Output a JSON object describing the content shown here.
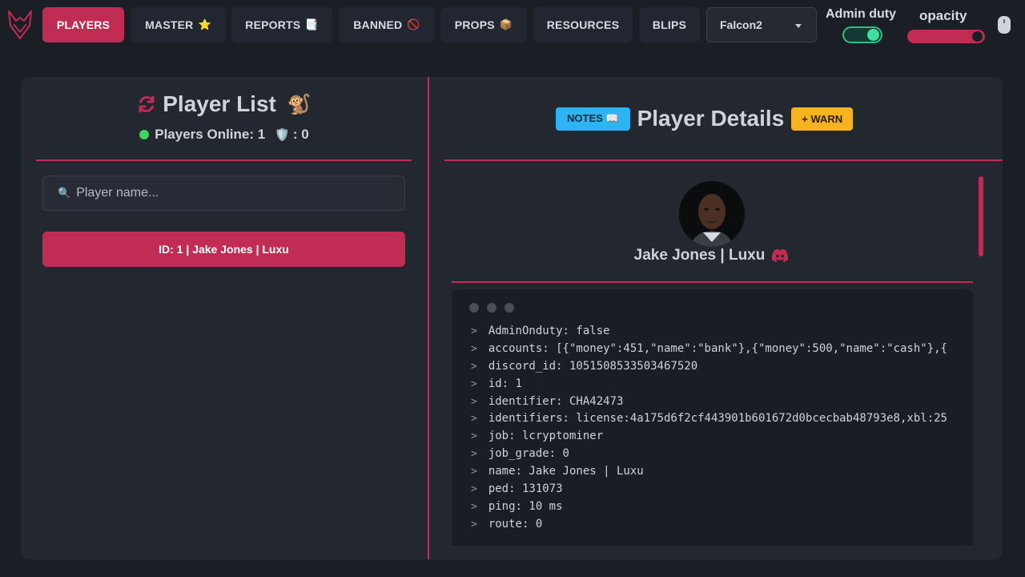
{
  "topbar": {
    "logo_icon": "fox-logo-icon",
    "nav": [
      {
        "label": "PLAYERS",
        "emoji": "",
        "active": true
      },
      {
        "label": "MASTER",
        "emoji": "⭐",
        "active": false
      },
      {
        "label": "REPORTS",
        "emoji": "📑",
        "active": false
      },
      {
        "label": "BANNED",
        "emoji": "🚫",
        "active": false
      },
      {
        "label": "PROPS",
        "emoji": "📦",
        "active": false
      },
      {
        "label": "RESOURCES",
        "emoji": "",
        "active": false
      },
      {
        "label": "BLIPS",
        "emoji": "",
        "active": false
      }
    ],
    "selected_option": "Falcon2",
    "admin_duty_label": "Admin duty",
    "admin_duty_on": true,
    "opacity_label": "opacity",
    "opacity_level": 0.9
  },
  "left": {
    "title": "Player List",
    "title_emoji": "🐒",
    "online_label": "Players Online: 1",
    "staff_count": ": 0",
    "search_placeholder": "Player name...",
    "players": [
      {
        "label": "ID: 1 | Jake Jones | Luxu"
      }
    ]
  },
  "right": {
    "notes_label": "NOTES 📖",
    "title": "Player Details",
    "warn_label": "+ WARN",
    "player_name": "Jake Jones | Luxu",
    "details": [
      "AdminOnduty: false",
      "accounts: [{\"money\":451,\"name\":\"bank\"},{\"money\":500,\"name\":\"cash\"},{",
      "discord_id: 1051508533503467520",
      "id: 1",
      "identifier: CHA42473",
      "identifiers: license:4a175d6f2cf443901b601672d0bcecbab48793e8,xbl:25",
      "job: lcryptominer",
      "job_grade: 0",
      "name: Jake Jones | Luxu",
      "ped: 131073",
      "ping: 10 ms",
      "route: 0"
    ]
  },
  "colors": {
    "accent": "#c12c55",
    "notes": "#2fb4f3",
    "warn": "#f4b31f",
    "online": "#41d65a"
  }
}
